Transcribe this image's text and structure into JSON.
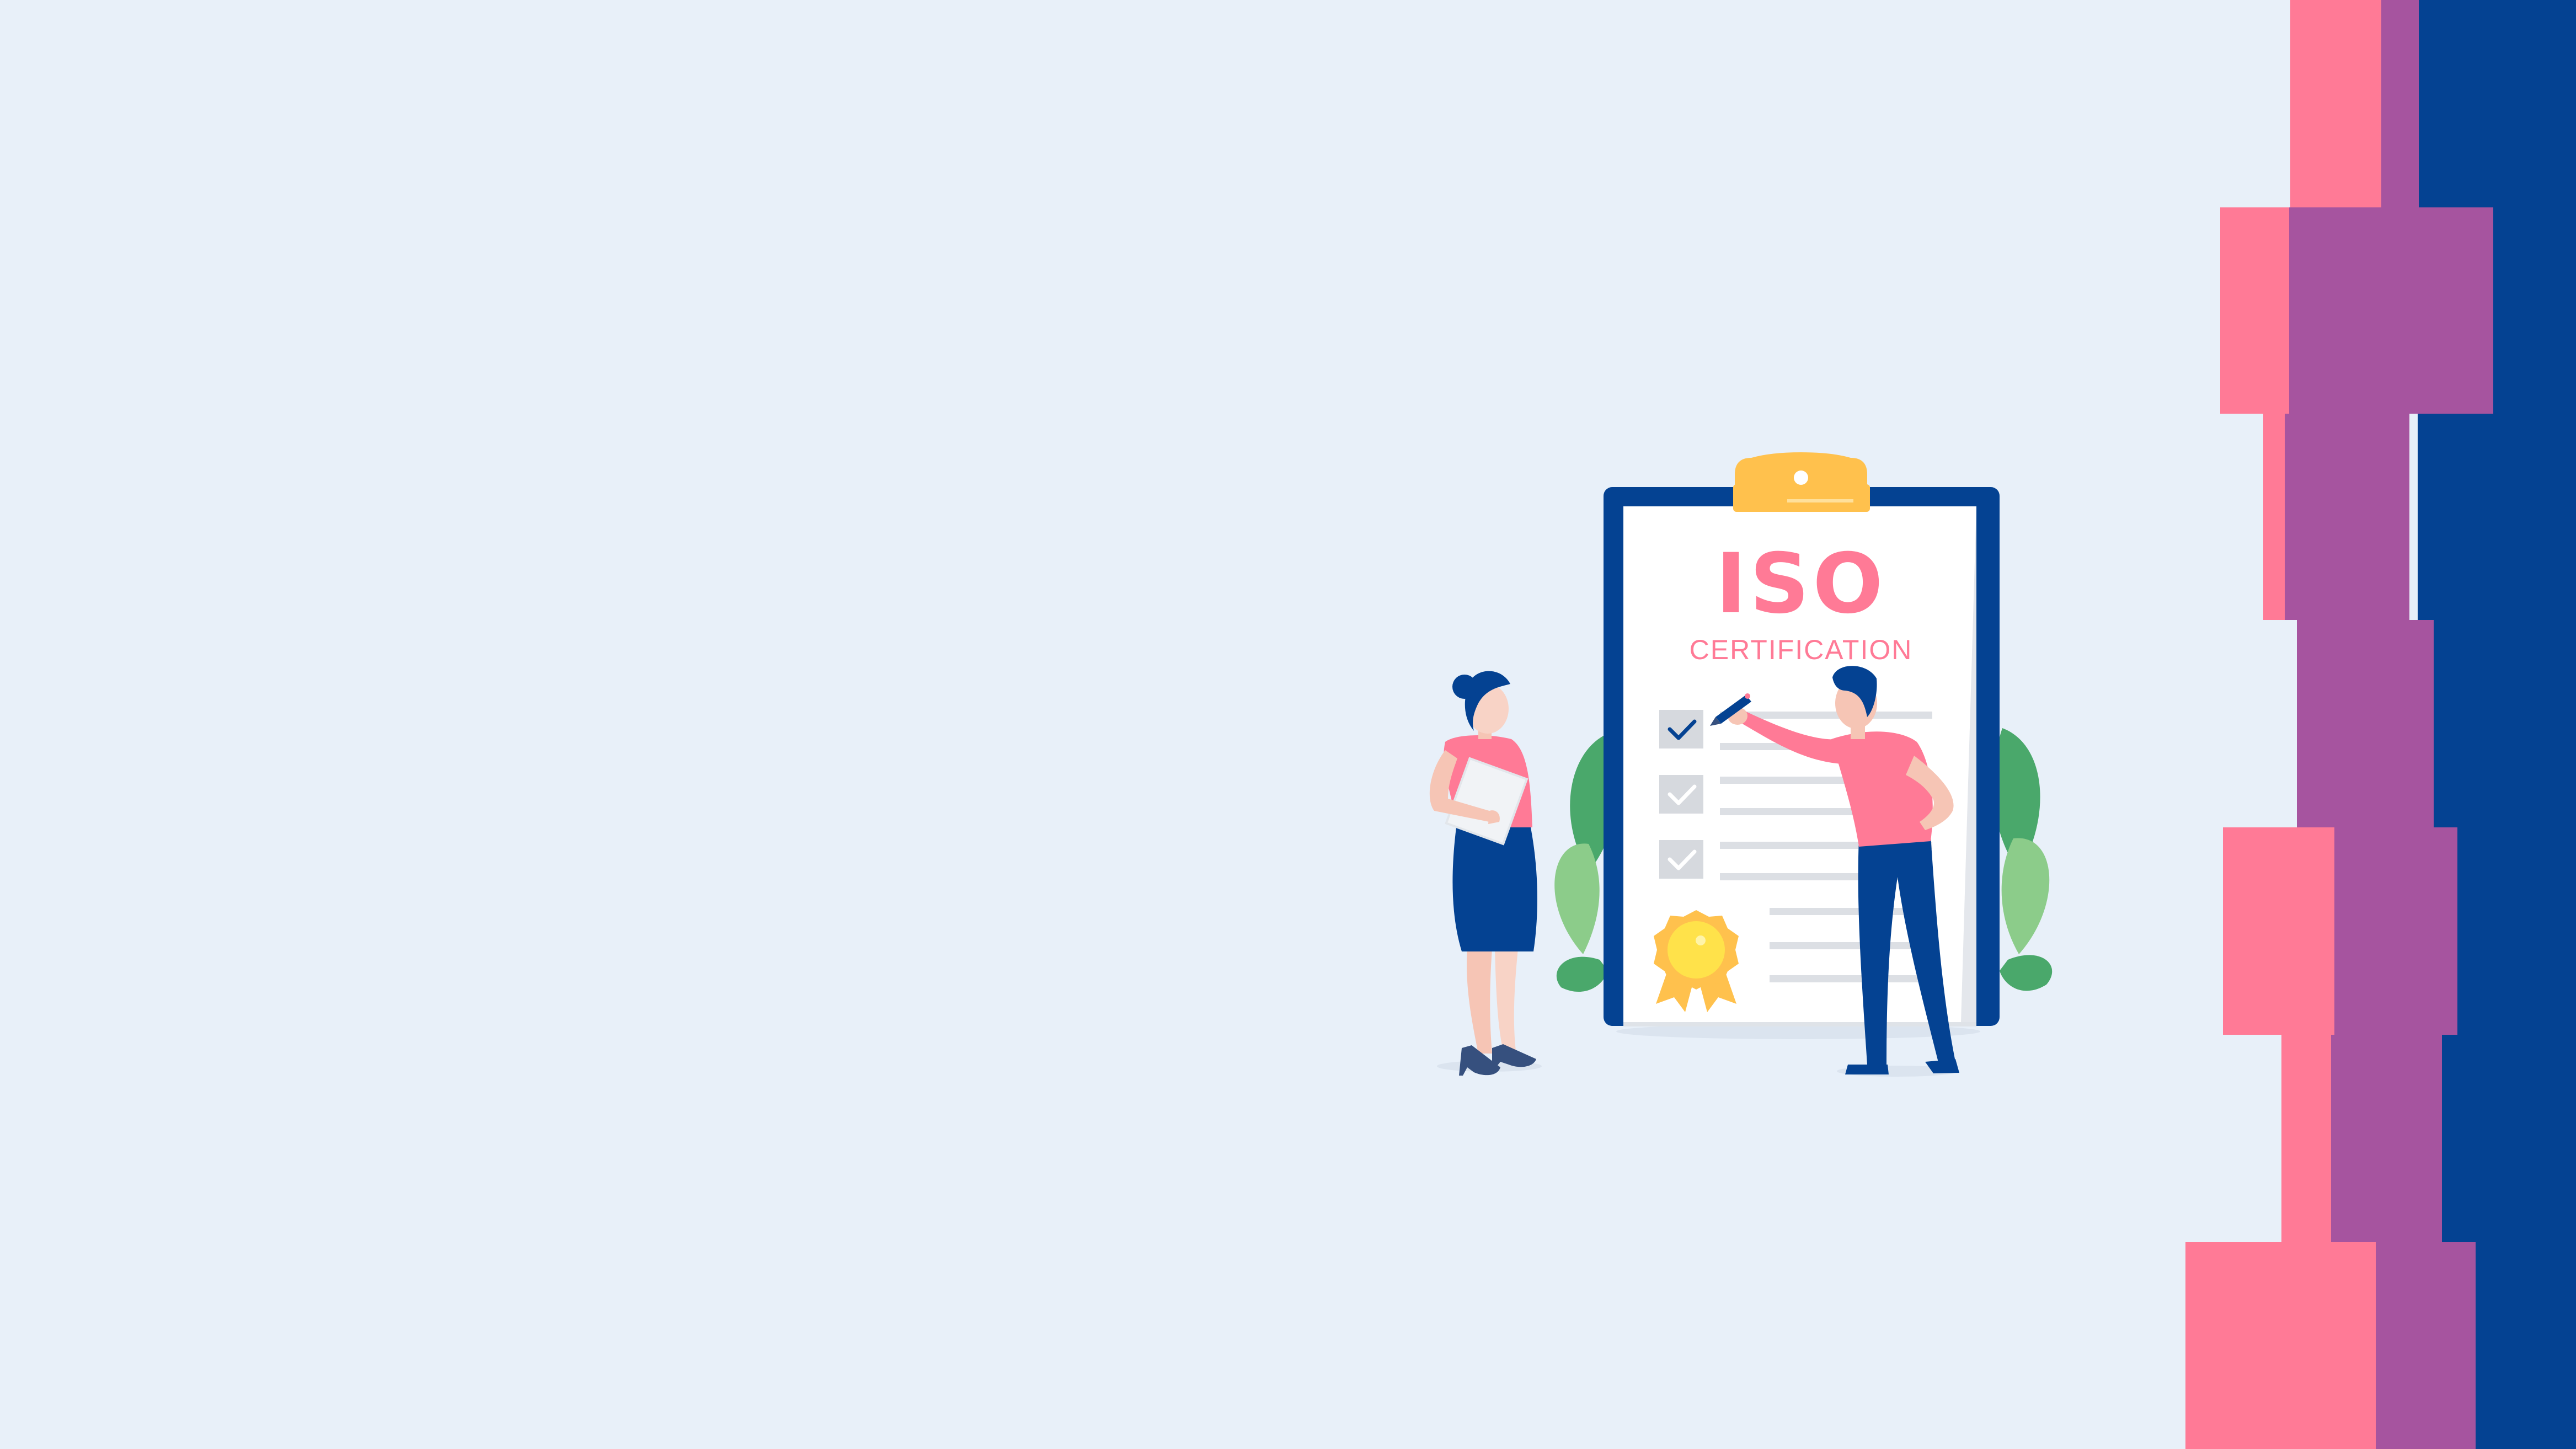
{
  "illustration": {
    "title": "ISO",
    "subtitle": "CERTIFICATION"
  },
  "colors": {
    "background": "#e8f0f9",
    "pink": "#ff7a96",
    "purple": "#a6549f",
    "navy": "#044292",
    "gold": "#ffc14d",
    "leaf_green": "#4aa86b",
    "leaf_light": "#8ccc8a"
  },
  "icons": [
    "clipboard-icon",
    "checkmark-icon",
    "award-seal-icon",
    "pen-icon"
  ]
}
